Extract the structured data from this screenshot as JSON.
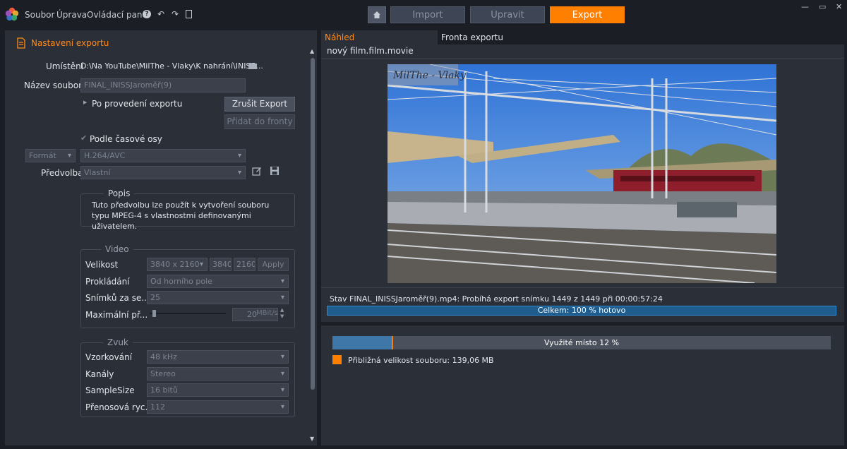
{
  "app": {
    "menu": [
      "Soubor",
      "Úprava",
      "Ovládací panel"
    ],
    "window_controls": [
      "—",
      "▭",
      "✕"
    ]
  },
  "nav": {
    "import_label": "Import",
    "edit_label": "Upravit",
    "export_label": "Export",
    "active": "Export"
  },
  "left": {
    "title": "Nastavení exportu",
    "location_label": "Umístění",
    "location_value": "D:\\Na YouTube\\MilThe - Vlaky\\K nahrání\\INISS...",
    "filename_label": "Název souboru",
    "filename_value": "FINAL_INISSJaroměř(9)",
    "after_export_label": "Po provedení exportu",
    "cancel_export_label": "Zrušit Export",
    "add_queue_label": "Přidat do fronty",
    "timeline_label": "Podle časové osy",
    "timeline_checked": true,
    "format_label": "Formát",
    "format_value": "H.264/AVC",
    "preset_label": "Předvolba",
    "preset_value": "Vlastní",
    "description_title": "Popis",
    "description_text": "Tuto předvolbu lze použít k vytvoření souboru typu MPEG-4 s vlastnostmi definovanými uživatelem.",
    "video": {
      "title": "Video",
      "size_label": "Velikost",
      "size_value": "3840 x 2160",
      "width": "3840",
      "height": "2160",
      "apply_label": "Apply",
      "interlace_label": "Prokládání",
      "interlace_value": "Od horního pole",
      "fps_label": "Snímků za se...",
      "fps_value": "25",
      "maxrate_label": "Maximální př...",
      "maxrate_value": "20",
      "maxrate_unit": "MBit/s",
      "maxrate_fraction": 0.02
    },
    "audio": {
      "title": "Zvuk",
      "samplerate_label": "Vzorkování",
      "samplerate_value": "48 kHz",
      "channels_label": "Kanály",
      "channels_value": "Stereo",
      "samplesize_label": "SampleSize",
      "samplesize_value": "16 bitů",
      "bitrate_label": "Přenosová ryc...",
      "bitrate_value": "112"
    }
  },
  "preview": {
    "tab_preview": "Náhled",
    "tab_queue": "Fronta exportu",
    "filename": "nový film.film.movie",
    "watermark": "MilThe - Vlaky",
    "status_text": "Stav FINAL_INISSJaroměř(9).mp4: Probíhá export snímku 1449 z 1449 při 00:00:57:24",
    "progress_label": "Celkem: 100 % hotovo",
    "progress_fraction": 1.0
  },
  "storage": {
    "usage_label": "Využité místo 12 %",
    "usage_fraction": 0.12,
    "estimate_label": "Přibližná velikost souboru: 139,06 MB",
    "estimate_color": "#ff7f00"
  },
  "colors": {
    "accent": "#ff7f00",
    "progress_fill": "#1e5d8e",
    "usage_fill": "#3f78a8"
  }
}
